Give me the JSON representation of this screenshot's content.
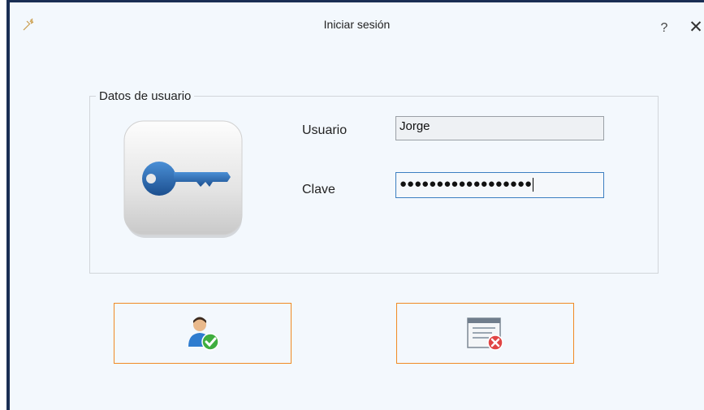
{
  "window": {
    "title": "Iniciar sesión",
    "help_label": "?",
    "close_label": "✕"
  },
  "group": {
    "legend": "Datos de usuario"
  },
  "form": {
    "user_label": "Usuario",
    "user_value": "Jorge",
    "password_label": "Clave",
    "password_mask": "●●●●●●●●●●●●●●●●●●"
  },
  "buttons": {
    "accept_icon": "user-check-icon",
    "cancel_icon": "window-cancel-icon"
  },
  "colors": {
    "window_border": "#1a2e54",
    "button_border": "#f08a24",
    "key_blue": "#2f6fb5",
    "focus_border": "#3c7fc1"
  }
}
